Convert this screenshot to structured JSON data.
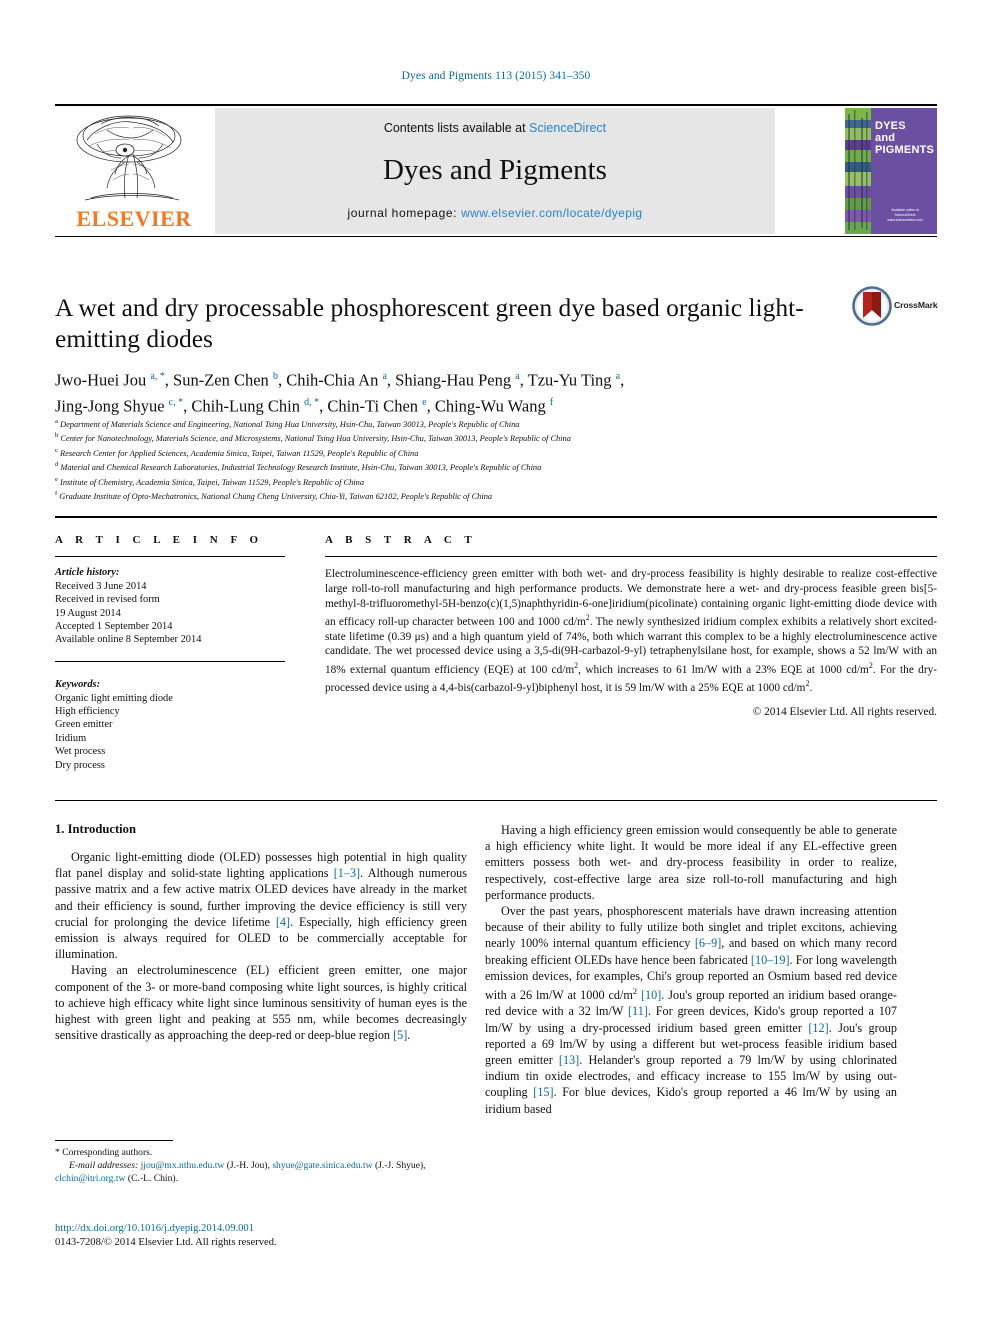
{
  "running_head": "Dyes and Pigments 113 (2015) 341–350",
  "masthead": {
    "contents_prefix": "Contents lists available at ",
    "sciencedirect": "ScienceDirect",
    "journal_title": "Dyes and Pigments",
    "homepage_label": "journal homepage: ",
    "homepage_url": "www.elsevier.com/locate/dyepig",
    "publisher": "ELSEVIER",
    "cover_title": "DYES and PIGMENTS",
    "cover_publisher": "Available online at\nScienceDirect\nwww.sciencedirect.com"
  },
  "article": {
    "title": "A wet and dry processable phosphorescent green dye based organic light-emitting diodes",
    "crossmark_label": "CrossMark",
    "authors_line1": "Jwo-Huei Jou",
    "authors": [
      {
        "name": "Jwo-Huei Jou",
        "sup": "a, *"
      },
      {
        "name": "Sun-Zen Chen",
        "sup": "b"
      },
      {
        "name": "Chih-Chia An",
        "sup": "a"
      },
      {
        "name": "Shiang-Hau Peng",
        "sup": "a"
      },
      {
        "name": "Tzu-Yu Ting",
        "sup": "a"
      },
      {
        "name": "Jing-Jong Shyue",
        "sup": "c, *"
      },
      {
        "name": "Chih-Lung Chin",
        "sup": "d, *"
      },
      {
        "name": "Chin-Ti Chen",
        "sup": "e"
      },
      {
        "name": "Ching-Wu Wang",
        "sup": "f"
      }
    ],
    "affiliations": [
      {
        "mark": "a",
        "text": "Department of Materials Science and Engineering, National Tsing Hua University, Hsin-Chu, Taiwan 30013, People's Republic of China"
      },
      {
        "mark": "b",
        "text": "Center for Nanotechnology, Materials Science, and Microsystems, National Tsing Hua University, Hsin-Chu, Taiwan 30013, People's Republic of China"
      },
      {
        "mark": "c",
        "text": "Research Center for Applied Sciences, Academia Sinica, Taipei, Taiwan 11529, People's Republic of China"
      },
      {
        "mark": "d",
        "text": "Material and Chemical Research Laboratories, Industrial Technology Research Institute, Hsin-Chu, Taiwan 30013, People's Republic of China"
      },
      {
        "mark": "e",
        "text": "Institute of Chemistry, Academia Sinica, Taipei, Taiwan 11529, People's Republic of China"
      },
      {
        "mark": "f",
        "text": "Graduate Institute of Opto-Mechatronics, National Chung Cheng University, Chia-Yi, Taiwan 62102, People's Republic of China"
      }
    ]
  },
  "article_info": {
    "heading": "A R T I C L E  I N F O",
    "history_label": "Article history:",
    "history": [
      "Received 3 June 2014",
      "Received in revised form",
      "19 August 2014",
      "Accepted 1 September 2014",
      "Available online 8 September 2014"
    ],
    "keywords_label": "Keywords:",
    "keywords": [
      "Organic light emitting diode",
      "High efficiency",
      "Green emitter",
      "Iridium",
      "Wet process",
      "Dry process"
    ]
  },
  "abstract": {
    "heading": "A B S T R A C T",
    "paragraph_1": "Electroluminescence-efficiency green emitter with both wet- and dry-process feasibility is highly desirable to realize cost-effective large roll-to-roll manufacturing and high performance products. We demonstrate here a wet- and dry-process feasible green bis[5-methyl-8-trifluoromethyl-5H-benzo(c)(1,5)naphthyridin-6-one]iridium(picolinate) containing organic light-emitting diode device with an efficacy roll-up character between 100 and 1000 cd/m",
    "frag_2": ". The newly synthesized iridium complex exhibits a relatively short excited-state lifetime (0.39 μs) and a high quantum yield of 74%, both which warrant this complex to be a highly electroluminescence active candidate. The wet processed device using a 3,5-di(9H-carbazol-9-yl) tetraphenylsilane host, for example, shows a 52 lm/W with an 18% external quantum efficiency (EQE) at 100 cd/m",
    "frag_3": ", which increases to 61 lm/W with a 23% EQE at 1000 cd/m",
    "frag_4": ". For the dry-processed device using a 4,4-bis(carbazol-9-yl)biphenyl host, it is 59 lm/W with a 25% EQE at 1000 cd/m",
    "frag_5": ".",
    "superscript": "2",
    "copyright": "© 2014 Elsevier Ltd. All rights reserved."
  },
  "introduction": {
    "heading": "1.  Introduction",
    "left": {
      "p1_a": "Organic light-emitting diode (OLED) possesses high potential in high quality flat panel display and solid-state lighting applications ",
      "p1_ref1": "[1–3]",
      "p1_b": ". Although numerous passive matrix and a few active matrix OLED devices have already in the market and their efficiency is sound, further improving the device efficiency is still very crucial for prolonging the device lifetime ",
      "p1_ref2": "[4]",
      "p1_c": ". Especially, high efficiency green emission is always required for OLED to be commercially acceptable for illumination.",
      "p2_a": "Having an electroluminescence (EL) efficient green emitter, one major component of the 3- or more-band composing white light sources, is highly critical to achieve high efficacy white light since luminous sensitivity of human eyes is the highest with green light and peaking at 555 nm, while becomes decreasingly sensitive drastically as approaching the deep-red or deep-blue region ",
      "p2_ref": "[5]",
      "p2_b": "."
    },
    "right": {
      "p1": "Having a high efficiency green emission would consequently be able to generate a high efficiency white light. It would be more ideal if any EL-effective green emitters possess both wet- and dry-process feasibility in order to realize, respectively, cost-effective large area size roll-to-roll manufacturing and high performance products.",
      "p2_a": "Over the past years, phosphorescent materials have drawn increasing attention because of their ability to fully utilize both singlet and triplet excitons, achieving nearly 100% internal quantum efficiency ",
      "p2_ref1": "[6–9]",
      "p2_b": ", and based on which many record breaking efficient OLEDs have hence been fabricated ",
      "p2_ref2": "[10–19]",
      "p2_c": ". For long wavelength emission devices, for examples, Chi's group reported an Osmium based red device with a 26 lm/W at 1000 cd/m",
      "p2_sup": "2",
      "p2_ref3": "[10]",
      "p2_d": ". Jou's group reported an iridium based orange-red device with a 32 lm/W ",
      "p2_ref4": "[11]",
      "p2_e": ". For green devices, Kido's group reported a 107 lm/W by using a dry-processed iridium based green emitter ",
      "p2_ref5": "[12]",
      "p2_f": ". Jou's group reported a 69 lm/W by using a different but wet-process feasible iridium based green emitter ",
      "p2_ref6": "[13]",
      "p2_g": ". Helander's group reported a 79 lm/W by using chlorinated indium tin oxide electrodes, and efficacy increase to 155 lm/W by using out-coupling ",
      "p2_ref7": "[15]",
      "p2_h": ". For blue devices, Kido's group reported a 46 lm/W by using an iridium based"
    }
  },
  "footnotes": {
    "star": "*",
    "corresponding": "Corresponding authors.",
    "email_label": "E-mail addresses:",
    "email1": "jjou@mx.nthu.edu.tw",
    "email1_owner": "(J.-H. Jou),",
    "email2": "shyue@gate.sinica.edu.tw",
    "email2_owner": "(J.-J. Shyue),",
    "email3": "clchin@itri.org.tw",
    "email3_owner": "(C.-L. Chin).",
    "doi": "http://dx.doi.org/10.1016/j.dyepig.2014.09.001",
    "issn": "0143-7208/© 2014 Elsevier Ltd. All rights reserved."
  },
  "colors": {
    "link_blue": "#0b6a9e",
    "sciencedirect_blue": "#2a84c8",
    "elsevier_orange": "#F47920",
    "cover_purple": "#6b4fa0",
    "crossmark_red": "#b32317"
  }
}
